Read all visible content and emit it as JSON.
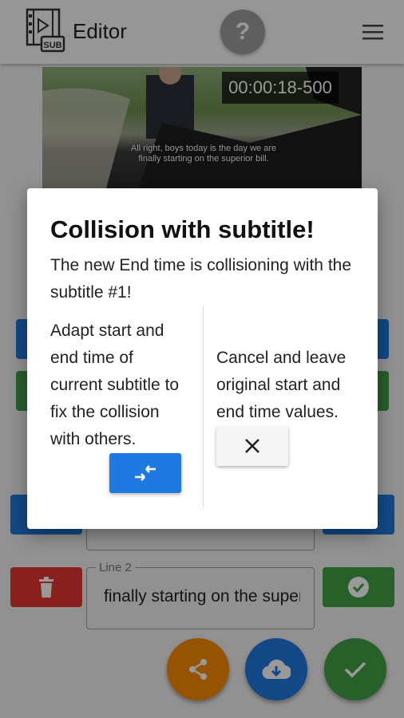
{
  "appbar": {
    "title": "Editor",
    "logo_text": "SUB",
    "help_glyph": "?"
  },
  "video": {
    "timecode": "00:00:18-500",
    "subtitle_line1": "All right, boys today is the day we are",
    "subtitle_line2": "finally starting on the superior bill."
  },
  "editor": {
    "line2_label": "Line 2",
    "line2_value": "finally starting on the superior bill."
  },
  "dialog": {
    "title": "Collision with subtitle!",
    "message": "The new End time is collisioning with the subtitle #1!",
    "adapt_text": "Adapt start and end time of current subtitle to fix the collision with others.",
    "cancel_text": "Cancel and leave original start and end time values."
  },
  "colors": {
    "blue": "#1e7ae0",
    "green": "#43a047",
    "red": "#e53935",
    "orange": "#fb8c00"
  }
}
